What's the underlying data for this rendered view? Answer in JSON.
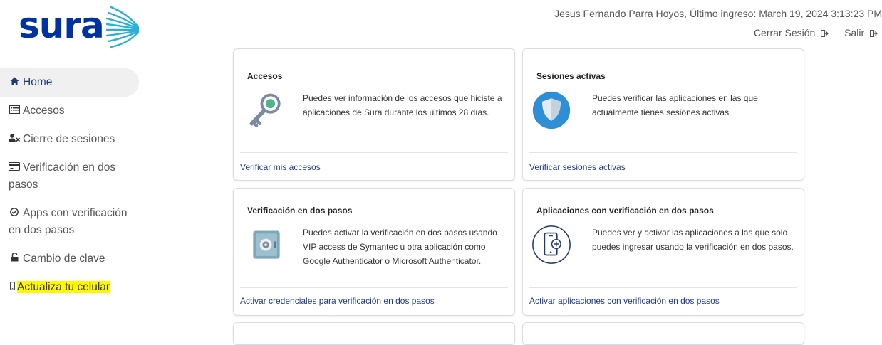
{
  "brand": {
    "logo_text": "sura",
    "logo_color": "#0033a0",
    "accent_color": "#2ab0d8"
  },
  "header": {
    "user_info": "Jesus Fernando Parra Hoyos, Último ingreso: March 19, 2024 3:13:23 PM",
    "logout_label": "Cerrar Sesión",
    "exit_label": "Salir",
    "logout_icon": "sign-out-icon"
  },
  "sidebar": {
    "items": [
      {
        "label": "Home",
        "icon": "home-icon",
        "active": true
      },
      {
        "label": "Accesos",
        "icon": "list-icon"
      },
      {
        "label": "Cierre de sesiones",
        "icon": "user-times-icon"
      },
      {
        "label": "Verificación en dos pasos",
        "icon": "credit-card-icon"
      },
      {
        "label": "Apps con verificación en dos pasos",
        "icon": "check-circle-icon"
      },
      {
        "label": "Cambio de clave",
        "icon": "lock-icon"
      },
      {
        "label": "Actualiza tu celular",
        "icon": "mobile-icon",
        "highlight_color": "#fff700"
      }
    ]
  },
  "cards": [
    {
      "title": "Accesos",
      "icon": "key-icon",
      "description": "Puedes ver información de los accesos que hiciste a aplicaciones de Sura durante los últimos 28 días.",
      "link": "Verificar mis accesos"
    },
    {
      "title": "Sesiones activas",
      "icon": "shield-icon",
      "description": "Puedes verificar las aplicaciones en las que actualmente tienes sesiones activas.",
      "link": "Verificar sesiones activas"
    },
    {
      "title": "Verificación en dos pasos",
      "icon": "safe-icon",
      "description": "Puedes activar la verificación en dos pasos usando VIP access de Symantec u otra aplicación como Google Authenticator o Microsoft Authenticator.",
      "link": "Activar credenciales para verificación en dos pasos"
    },
    {
      "title": "Aplicaciones con verificación en dos pasos",
      "icon": "phone-add-icon",
      "description": "Puedes ver y activar las aplicaciones a las que solo puedes ingresar usando la verificación en dos pasos.",
      "link": "Activar aplicaciones con verificación en dos pasos"
    }
  ]
}
